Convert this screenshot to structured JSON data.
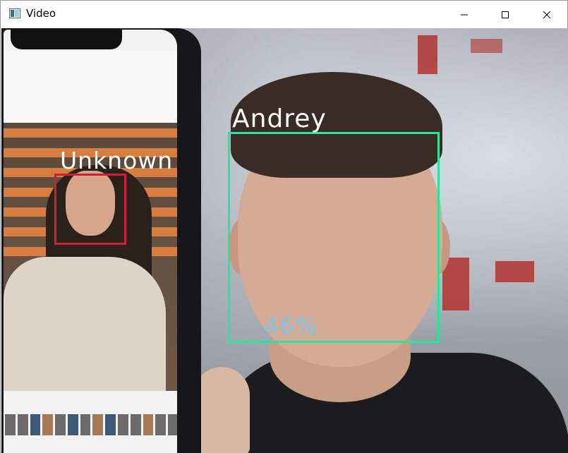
{
  "window": {
    "title": "Video",
    "app_icon": "app-window-icon",
    "controls": [
      "minimize-icon",
      "maximize-icon",
      "close-icon"
    ]
  },
  "detections": [
    {
      "label": "Unknown",
      "color": "#d11c3a"
    },
    {
      "label": "Andrey",
      "color": "#27e59b",
      "confidence": "46%",
      "confidence_color": "#79c7e8"
    }
  ],
  "colors": {
    "titlebar": "#ffffff",
    "title_text": "#000000",
    "label_text": "#ffffff"
  }
}
